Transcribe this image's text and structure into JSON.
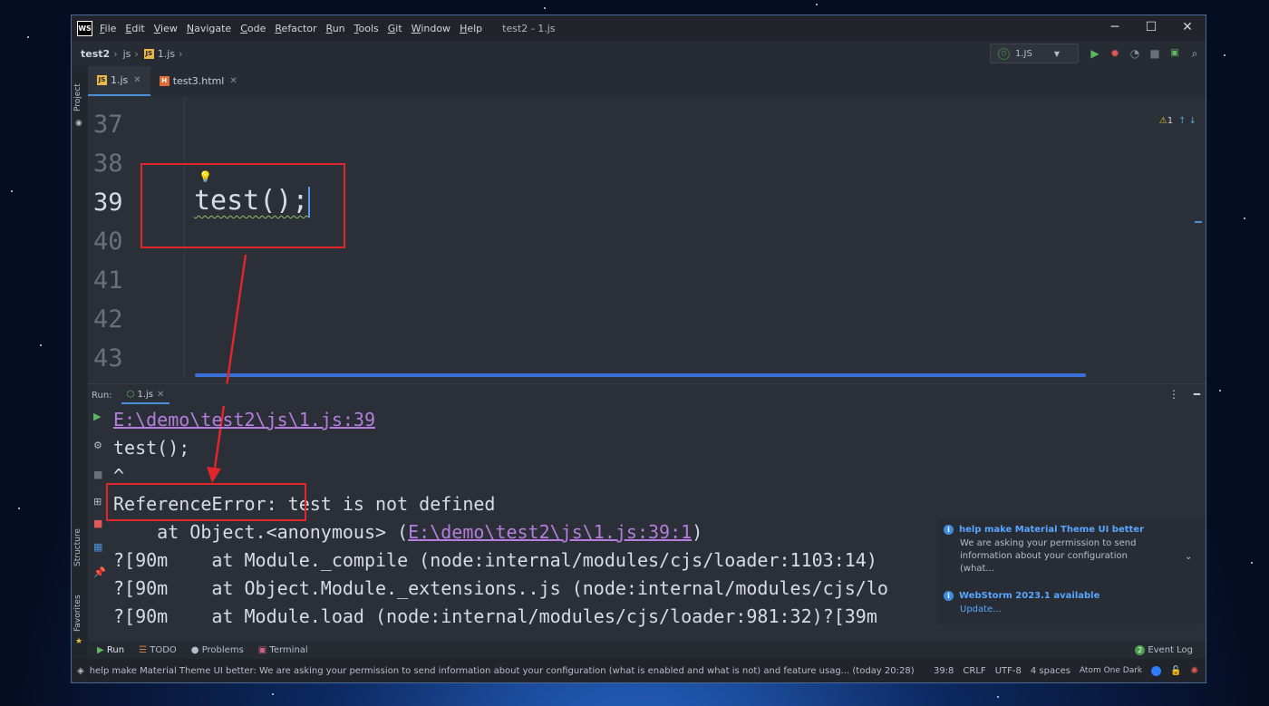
{
  "window": {
    "app_logo": "WS",
    "menu": [
      "File",
      "Edit",
      "View",
      "Navigate",
      "Code",
      "Refactor",
      "Run",
      "Tools",
      "Git",
      "Window",
      "Help"
    ],
    "title": "test2 - 1.js",
    "controls": {
      "minimize": "─",
      "maximize": "☐",
      "close": "✕"
    }
  },
  "breadcrumb": {
    "project": "test2",
    "folder": "js",
    "file": "1.js"
  },
  "run_config": {
    "label": "1.JS",
    "icons": [
      "run-icon",
      "debug-icon",
      "coverage-icon",
      "stop-icon",
      "terminal-icon",
      "search-icon"
    ]
  },
  "tabs": [
    {
      "label": "1.js",
      "icon": "JS",
      "active": true
    },
    {
      "label": "test3.html",
      "icon": "H",
      "active": false
    }
  ],
  "side_panels": {
    "project": "Project",
    "structure": "Structure",
    "favorites": "Favorites"
  },
  "editor": {
    "line_numbers": [
      "37",
      "38",
      "39",
      "40",
      "41",
      "42",
      "43"
    ],
    "current_line": "39",
    "code_line": "test();",
    "inspection": {
      "warnings": "1",
      "icon": "warning-icon"
    }
  },
  "run_panel": {
    "label": "Run:",
    "tab": "1.js",
    "output": {
      "path_link": "E:\\demo\\test2\\js\\1.js:39",
      "source": "test();",
      "caret": "^",
      "error_type": "ReferenceError:",
      "error_msg": " test is not defined",
      "trace1_prefix": "    at Object.<anonymous> (",
      "trace1_link": "E:\\demo\\test2\\js\\1.js:39:1",
      "trace1_suffix": ")",
      "trace2": "?[90m    at Module._compile (node:internal/modules/cjs/loader:1103:14)",
      "trace3": "?[90m    at Object.Module._extensions..js (node:internal/modules/cjs/lo",
      "trace4": "?[90m    at Module.load (node:internal/modules/cjs/loader:981:32)?[39m"
    }
  },
  "notifications": [
    {
      "title": "help make Material Theme UI better",
      "body": "We are asking your permission to send information about your configuration (what..."
    },
    {
      "title": "WebStorm 2023.1 available",
      "body": "Update..."
    }
  ],
  "bottom_tools": [
    "Run",
    "TODO",
    "Problems",
    "Terminal"
  ],
  "event_log": "Event Log",
  "event_log_badge": "2",
  "status": {
    "message": "help make Material Theme UI better: We are asking your permission to send information about your configuration (what is enabled and what is not) and feature usag... (today 20:28)",
    "position": "39:8",
    "line_sep": "CRLF",
    "encoding": "UTF-8",
    "indent": "4 spaces",
    "theme": "Atom One Dark"
  },
  "colors": {
    "accent": "#4a90d9",
    "error_box": "#e0262a",
    "link": "#b57edc",
    "notif_title": "#58a6ff"
  }
}
